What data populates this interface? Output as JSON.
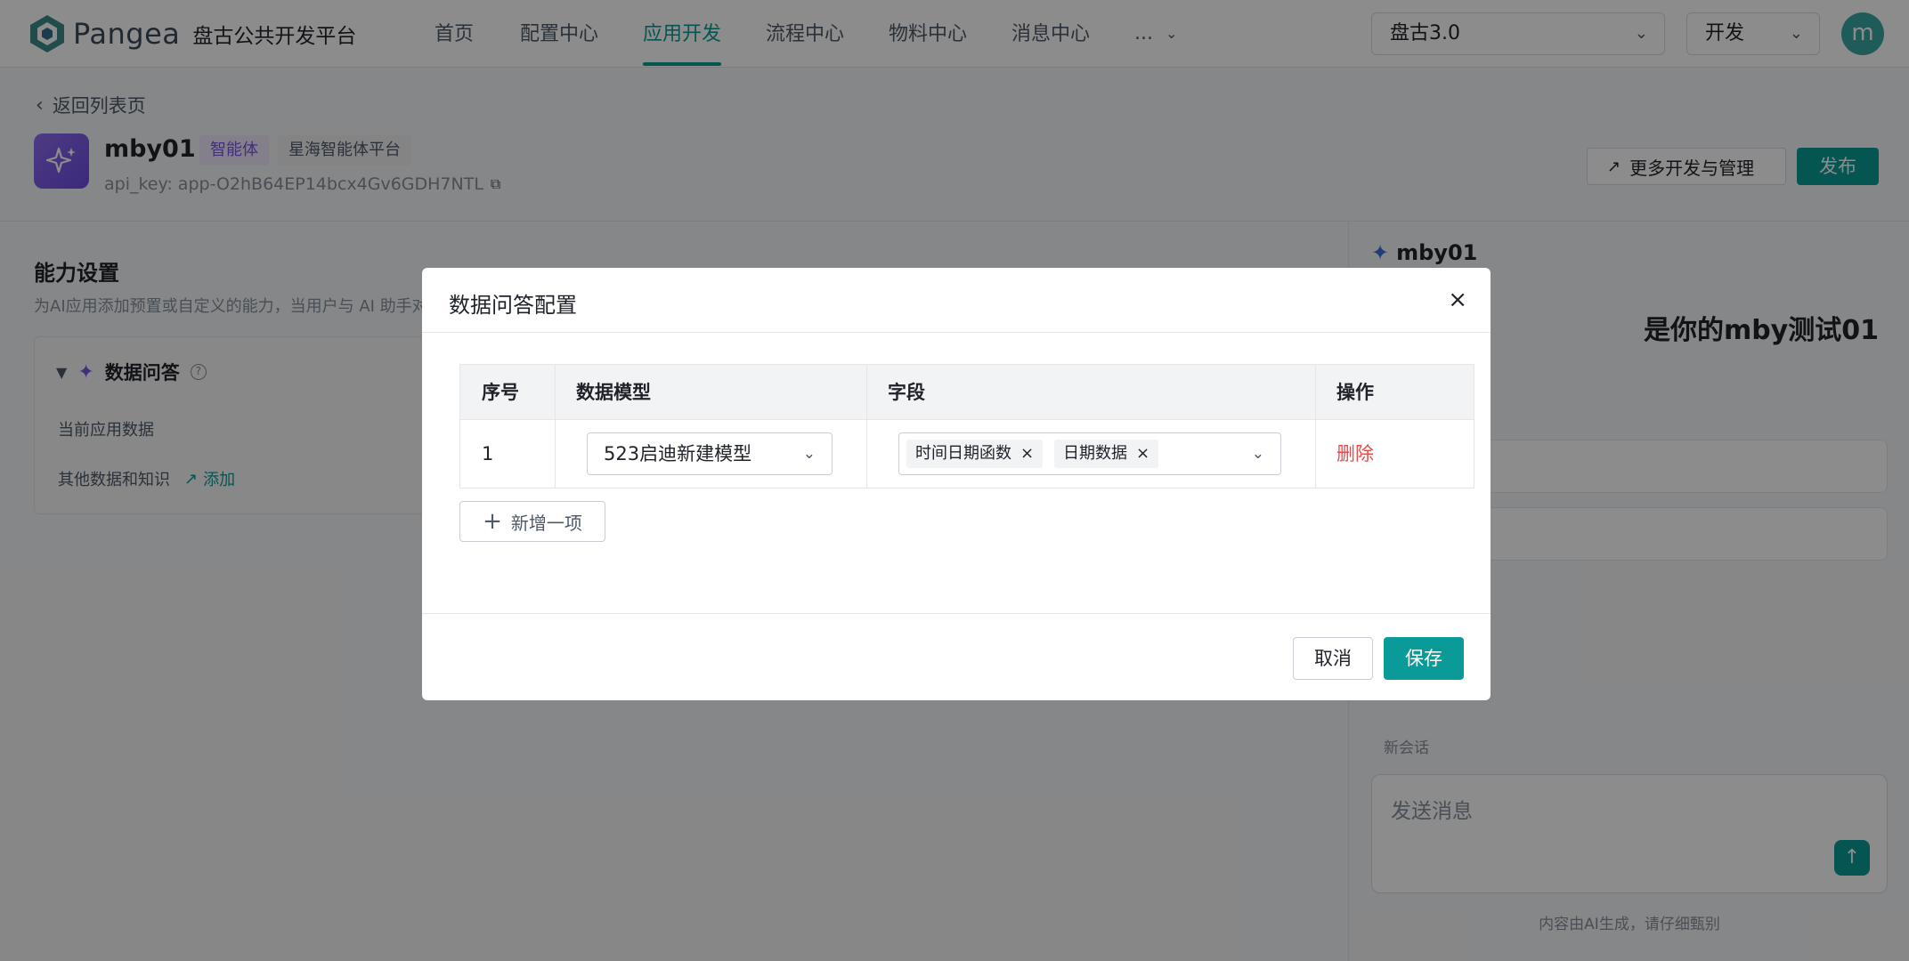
{
  "topnav": {
    "logo_name": "Pangea",
    "logo_subtitle": "盘古公共开发平台",
    "items": [
      {
        "label": "首页"
      },
      {
        "label": "配置中心"
      },
      {
        "label": "应用开发"
      },
      {
        "label": "流程中心"
      },
      {
        "label": "物料中心"
      },
      {
        "label": "消息中心"
      },
      {
        "label": "..."
      }
    ],
    "active_item": "应用开发",
    "version_select": "盘古3.0",
    "env_select": "开发",
    "avatar_letter": "m"
  },
  "header": {
    "back_label": "返回列表页",
    "app_name": "mby01",
    "tags": [
      "智能体",
      "星海智能体平台"
    ],
    "api_key": "api_key: app-O2hB64EP14bcx4Gv6GDH7NTL",
    "more_button": "更多开发与管理",
    "publish_button": "发布"
  },
  "capability": {
    "title": "能力设置",
    "description": "为AI应用添加预置或自定义的能力，当用户与 AI 助手对",
    "card_title": "数据问答",
    "current_data_label": "当前应用数据",
    "other_data_label": "其他数据和知识",
    "add_label": "添加"
  },
  "chat": {
    "bot_name": "mby01",
    "greeting": "是你的mby测试01",
    "new_session": "新会话",
    "input_placeholder": "发送消息",
    "ai_note": "内容由AI生成，请仔细甄别"
  },
  "modal": {
    "title": "数据问答配置",
    "columns": [
      "序号",
      "数据模型",
      "字段",
      "操作"
    ],
    "rows": [
      {
        "index": "1",
        "model": "523启迪新建模型",
        "fields": [
          "时间日期函数",
          "日期数据"
        ],
        "action": "删除"
      }
    ],
    "add_item": "新增一项",
    "cancel": "取消",
    "save": "保存"
  },
  "colors": {
    "accent": "#0a9b98",
    "danger": "#e34d4d",
    "purple": "#7a55e5"
  }
}
